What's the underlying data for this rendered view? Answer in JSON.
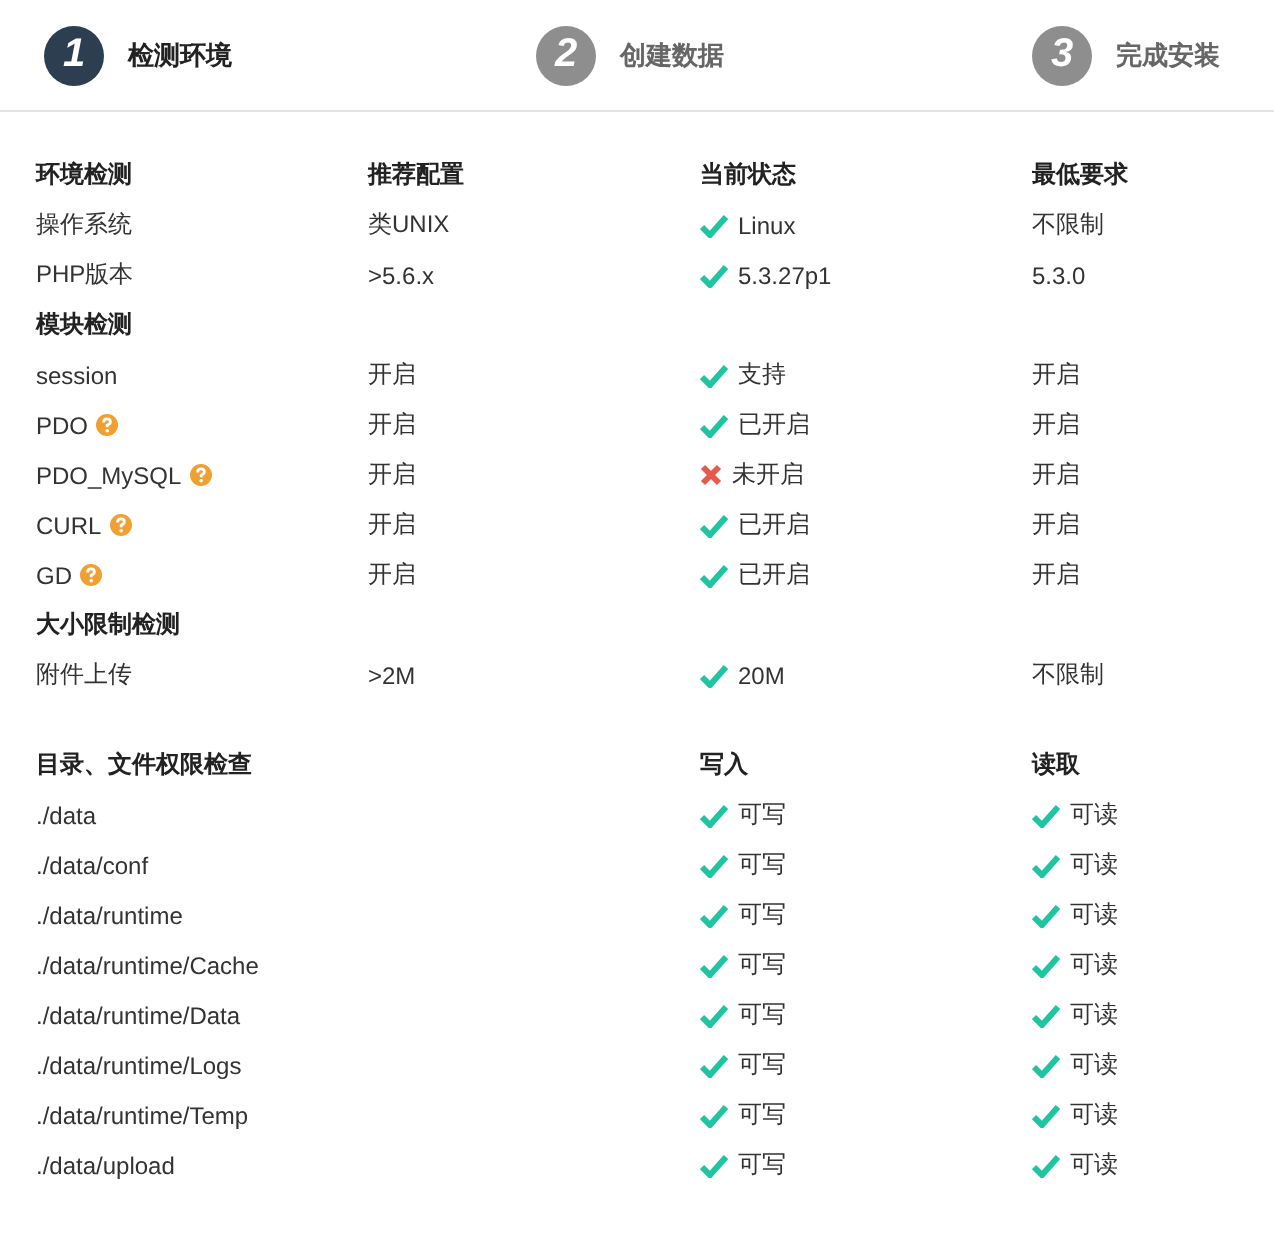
{
  "steps": [
    {
      "number": "1",
      "label": "检测环境",
      "selected": true
    },
    {
      "number": "2",
      "label": "创建数据",
      "selected": false
    },
    {
      "number": "3",
      "label": "完成安装",
      "selected": false
    }
  ],
  "env_table": {
    "columns": [
      "环境检测",
      "推荐配置",
      "当前状态",
      "最低要求"
    ],
    "rows": [
      {
        "name": "操作系统",
        "help": false,
        "recommended": "类UNIX",
        "current": {
          "passed": true,
          "text": "Linux"
        },
        "minimum": "不限制"
      },
      {
        "name": "PHP版本",
        "help": false,
        "recommended": ">5.6.x",
        "current": {
          "passed": true,
          "text": "5.3.27p1"
        },
        "minimum": "5.3.0"
      }
    ],
    "sections": [
      {
        "title": "模块检测",
        "rows": [
          {
            "name": "session",
            "help": false,
            "recommended": "开启",
            "current": {
              "passed": true,
              "text": "支持"
            },
            "minimum": "开启"
          },
          {
            "name": "PDO",
            "help": true,
            "recommended": "开启",
            "current": {
              "passed": true,
              "text": "已开启"
            },
            "minimum": "开启"
          },
          {
            "name": "PDO_MySQL",
            "help": true,
            "recommended": "开启",
            "current": {
              "passed": false,
              "text": "未开启"
            },
            "minimum": "开启"
          },
          {
            "name": "CURL",
            "help": true,
            "recommended": "开启",
            "current": {
              "passed": true,
              "text": "已开启"
            },
            "minimum": "开启"
          },
          {
            "name": "GD",
            "help": true,
            "recommended": "开启",
            "current": {
              "passed": true,
              "text": "已开启"
            },
            "minimum": "开启"
          }
        ]
      },
      {
        "title": "大小限制检测",
        "rows": [
          {
            "name": "附件上传",
            "help": false,
            "recommended": ">2M",
            "current": {
              "passed": true,
              "text": "20M"
            },
            "minimum": "不限制"
          }
        ]
      }
    ]
  },
  "dir_table": {
    "columns": [
      "目录、文件权限检查",
      "写入",
      "读取"
    ],
    "rows": [
      {
        "path": "./data",
        "write": {
          "passed": true,
          "text": "可写"
        },
        "read": {
          "passed": true,
          "text": "可读"
        }
      },
      {
        "path": "./data/conf",
        "write": {
          "passed": true,
          "text": "可写"
        },
        "read": {
          "passed": true,
          "text": "可读"
        }
      },
      {
        "path": "./data/runtime",
        "write": {
          "passed": true,
          "text": "可写"
        },
        "read": {
          "passed": true,
          "text": "可读"
        }
      },
      {
        "path": "./data/runtime/Cache",
        "write": {
          "passed": true,
          "text": "可写"
        },
        "read": {
          "passed": true,
          "text": "可读"
        }
      },
      {
        "path": "./data/runtime/Data",
        "write": {
          "passed": true,
          "text": "可写"
        },
        "read": {
          "passed": true,
          "text": "可读"
        }
      },
      {
        "path": "./data/runtime/Logs",
        "write": {
          "passed": true,
          "text": "可写"
        },
        "read": {
          "passed": true,
          "text": "可读"
        }
      },
      {
        "path": "./data/runtime/Temp",
        "write": {
          "passed": true,
          "text": "可写"
        },
        "read": {
          "passed": true,
          "text": "可读"
        }
      },
      {
        "path": "./data/upload",
        "write": {
          "passed": true,
          "text": "可写"
        },
        "read": {
          "passed": true,
          "text": "可读"
        }
      }
    ]
  }
}
